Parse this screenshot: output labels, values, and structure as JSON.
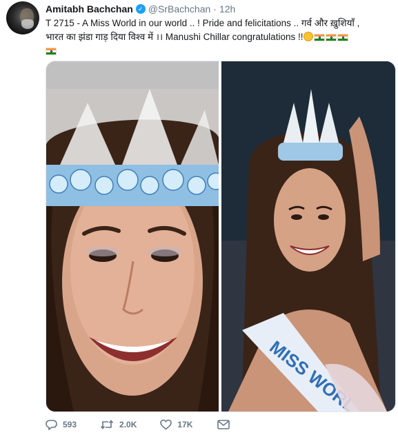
{
  "tweet": {
    "author_name": "Amitabh Bachchan",
    "handle": "@SrBachchan",
    "separator": "·",
    "time": "12h",
    "verified_glyph": "✓",
    "text_line1": "T 2715 - A Miss World in our world .. ! Pride and felicitations .. गर्व और ख़ुशियाँ ,",
    "text_line2": "भारत का झंडा गाड़ दिया विश्व में  ।। Manushi Chillar congratulations !!",
    "emojis": [
      "rofl-emoji",
      "india-flag",
      "india-flag",
      "india-flag",
      "india-flag"
    ],
    "photos": {
      "sash_text": "MISS WORL",
      "colors": {
        "crown": "#9ec8e6",
        "crown_dark": "#3e7fb8",
        "sash": "#e8eef7",
        "sash_text": "#2f6fb5"
      }
    },
    "actions": {
      "replies": "593",
      "retweets": "2.0K",
      "likes": "17K"
    }
  }
}
